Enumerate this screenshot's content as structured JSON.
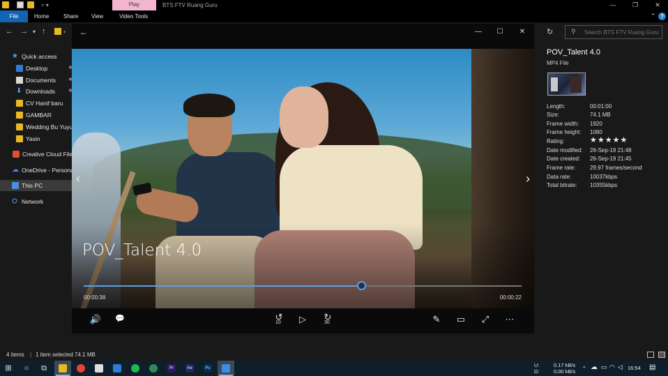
{
  "titlebar": {
    "play_tab": "Play",
    "window_title": "BTS FTV Ruang Guru",
    "minimize": "—",
    "restore": "❐",
    "close": "✕",
    "qa_separator": "= ▾"
  },
  "ribbon": {
    "tabs": [
      "File",
      "Home",
      "Share",
      "View",
      "Video Tools"
    ],
    "collapse": "⌃",
    "help": "?"
  },
  "address": {
    "back": "←",
    "forward": "→",
    "recent": "▾",
    "up": "↑",
    "crumb_sep": "›",
    "refresh": "↻",
    "search_placeholder": "Search BTS FTV Ruang Guru"
  },
  "sidebar": {
    "items": [
      {
        "label": "Quick access",
        "icon": "star-icon"
      },
      {
        "label": "Desktop",
        "icon": "desktop-icon"
      },
      {
        "label": "Documents",
        "icon": "documents-icon"
      },
      {
        "label": "Downloads",
        "icon": "downloads-icon"
      },
      {
        "label": "CV Hanif baru",
        "icon": "folder-icon"
      },
      {
        "label": "GAMBAR",
        "icon": "folder-icon"
      },
      {
        "label": "Wedding Bu Yuyu",
        "icon": "folder-icon"
      },
      {
        "label": "Yasin",
        "icon": "folder-icon"
      },
      {
        "label": "Creative Cloud Files",
        "icon": "creative-cloud-icon"
      },
      {
        "label": "OneDrive - Personal",
        "icon": "onedrive-icon"
      },
      {
        "label": "This PC",
        "icon": "pc-icon"
      },
      {
        "label": "Network",
        "icon": "network-icon"
      }
    ]
  },
  "player": {
    "back": "←",
    "minimize": "—",
    "maximize": "☐",
    "close": "✕",
    "video_title": "POV_Talent 4.0",
    "prev": "‹",
    "next": "›",
    "elapsed": "00:00:38",
    "remaining": "00:00:22",
    "progress": 0.633,
    "skip_back_seconds": "10",
    "skip_forward_seconds": "30",
    "volume_icon": "🔊",
    "subtitles_icon": "💬",
    "play_icon": "▷",
    "edit_icon": "✎",
    "miniview_icon": "▭",
    "fullscreen_icon": "⤢",
    "more_icon": "⋯"
  },
  "details": {
    "name": "POV_Talent 4.0",
    "type": "MP4 File",
    "properties": [
      {
        "label": "Length:",
        "value": "00:01:00"
      },
      {
        "label": "Size:",
        "value": "74.1 MB"
      },
      {
        "label": "Frame width:",
        "value": "1920"
      },
      {
        "label": "Frame height:",
        "value": "1080"
      },
      {
        "label": "Rating:",
        "value": "★★★★★"
      },
      {
        "label": "Date modified:",
        "value": "26-Sep-19 21:48"
      },
      {
        "label": "Date created:",
        "value": "26-Sep-19 21:45"
      },
      {
        "label": "Frame rate:",
        "value": "29.97 frames/second"
      },
      {
        "label": "Data rate:",
        "value": "10037kbps"
      },
      {
        "label": "Total bitrate:",
        "value": "10355kbps"
      }
    ]
  },
  "statusbar": {
    "items_count": "4 items",
    "separator": "|",
    "selection": "1 item selected  74.1 MB"
  },
  "taskbar": {
    "start_icon": "⊞",
    "search_icon": "○",
    "taskview_icon": "⧉",
    "apps": [
      {
        "label": "",
        "name": "file-explorer-icon",
        "color": "#e8b923"
      },
      {
        "label": "",
        "name": "chrome-icon",
        "color": "#e94235"
      },
      {
        "label": "",
        "name": "store-icon",
        "color": "#dddddd"
      },
      {
        "label": "",
        "name": "photos-icon",
        "color": "#2d7dd2"
      },
      {
        "label": "",
        "name": "spotify-icon",
        "color": "#1db954"
      },
      {
        "label": "",
        "name": "camtasia-icon",
        "color": "#2e8b57"
      },
      {
        "label": "Pr",
        "name": "premiere-icon",
        "color": "#2a1d5c"
      },
      {
        "label": "Ae",
        "name": "after-effects-icon",
        "color": "#1f2a5c"
      },
      {
        "label": "Ps",
        "name": "photoshop-icon",
        "color": "#0d2a4a"
      },
      {
        "label": "",
        "name": "movies-tv-icon",
        "color": "#3a8ee6"
      }
    ],
    "upload_label": "U:",
    "download_label": "D:",
    "upload_speed": "0.17 kB/s",
    "download_speed": "0.00 kB/s",
    "tray_chevron": "^",
    "time": "16:54",
    "notification_icon": "▤"
  }
}
